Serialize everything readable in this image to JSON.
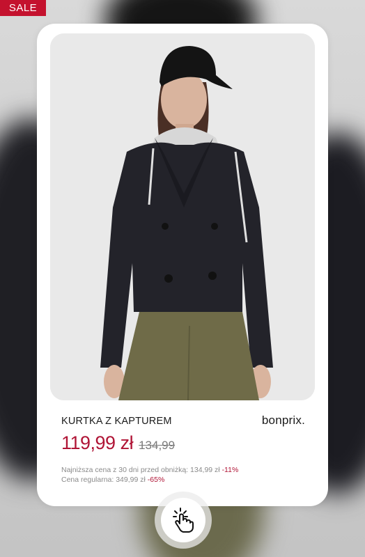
{
  "badge": {
    "label": "SALE"
  },
  "product": {
    "name": "KURTKA Z KAPTUREM",
    "brand": "bonprix.",
    "price_current": "119,99 zł",
    "price_old": "134,99",
    "lowest_price_label": "Najniższa cena z 30 dni przed obniżką: 134,99 zł",
    "lowest_price_discount": "-11%",
    "regular_price_label": "Cena regularna: 349,99 zł",
    "regular_price_discount": "-65%"
  },
  "icons": {
    "tap": "tap-hand-icon"
  },
  "colors": {
    "sale": "#c4122e",
    "price": "#b01536"
  }
}
